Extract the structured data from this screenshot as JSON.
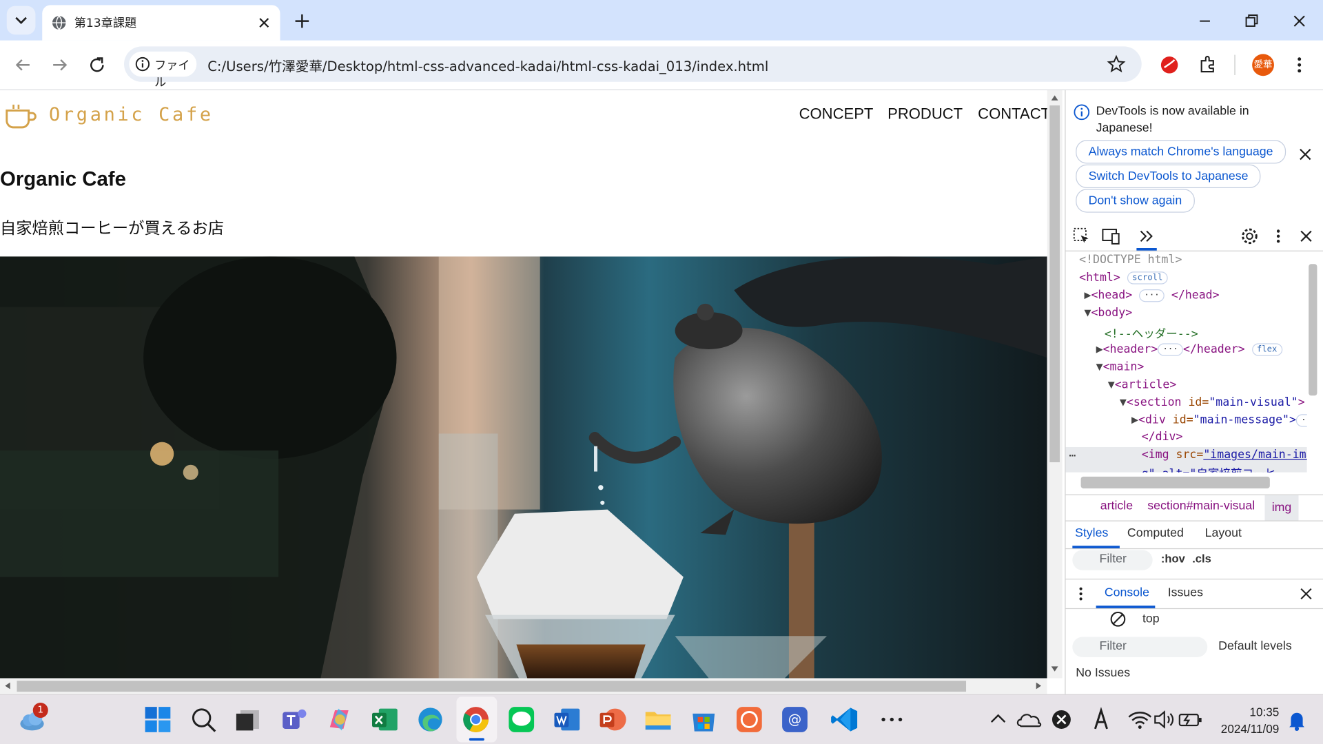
{
  "browser": {
    "tab_title": "第13章課題",
    "file_chip": "ファイル",
    "url": "C:/Users/竹澤愛華/Desktop/html-css-advanced-kadai/html-css-kadai_013/index.html",
    "profile_initials": "愛華"
  },
  "page": {
    "logo_text": "Organic Cafe",
    "nav": [
      "CONCEPT",
      "PRODUCT",
      "CONTACT"
    ],
    "heading": "Organic Cafe",
    "subheading": "自家焙煎コーヒーが買えるお店",
    "hero_alt": "自家焙煎コーヒー"
  },
  "devtools": {
    "notice": "DevTools is now available in Japanese!",
    "btn_match": "Always match Chrome's language",
    "btn_switch": "Switch DevTools to Japanese",
    "btn_dont": "Don't show again",
    "dom": {
      "doctype": "<!DOCTYPE html>",
      "html": "<html>",
      "scroll_badge": "scroll",
      "head_open": "<head>",
      "head_close": "</head>",
      "body": "<body>",
      "comment": "<!--ヘッダー-->",
      "header_open": "<header>",
      "header_close": "</header>",
      "flex_badge": "flex",
      "main": "<main>",
      "article": "<article>",
      "section_tag": "<section",
      "section_attr": "id=",
      "section_val": "\"main-visual\"",
      "div_tag": "<div",
      "div_attr": "id=",
      "div_val": "\"main-message\">",
      "div_close": "</div>",
      "img_tag": "<img",
      "img_attr": "src=",
      "img_val": "\"images/main-image",
      "img_line2": "g\" alt=\"自家焙煎コーヒ",
      "ellipsis": "…",
      "gt": ">"
    },
    "breadcrumbs": [
      "article",
      "section#main-visual",
      "img"
    ],
    "style_tabs": [
      "Styles",
      "Computed",
      "Layout"
    ],
    "filter_placeholder": "Filter",
    "hov": ":hov",
    "cls": ".cls",
    "drawer_tabs": [
      "Console",
      "Issues"
    ],
    "context": "top",
    "console_filter": "Filter",
    "levels": "Default levels",
    "no_issues": "No Issues"
  },
  "taskbar": {
    "time": "10:35",
    "date": "2024/11/09",
    "weather_badge": "1"
  },
  "colors": {
    "tabstrip": "#d3e3fd",
    "accent_blue": "#0b57d0",
    "logo_gold": "#d4a24a",
    "taskbar": "#e7e3e8"
  }
}
